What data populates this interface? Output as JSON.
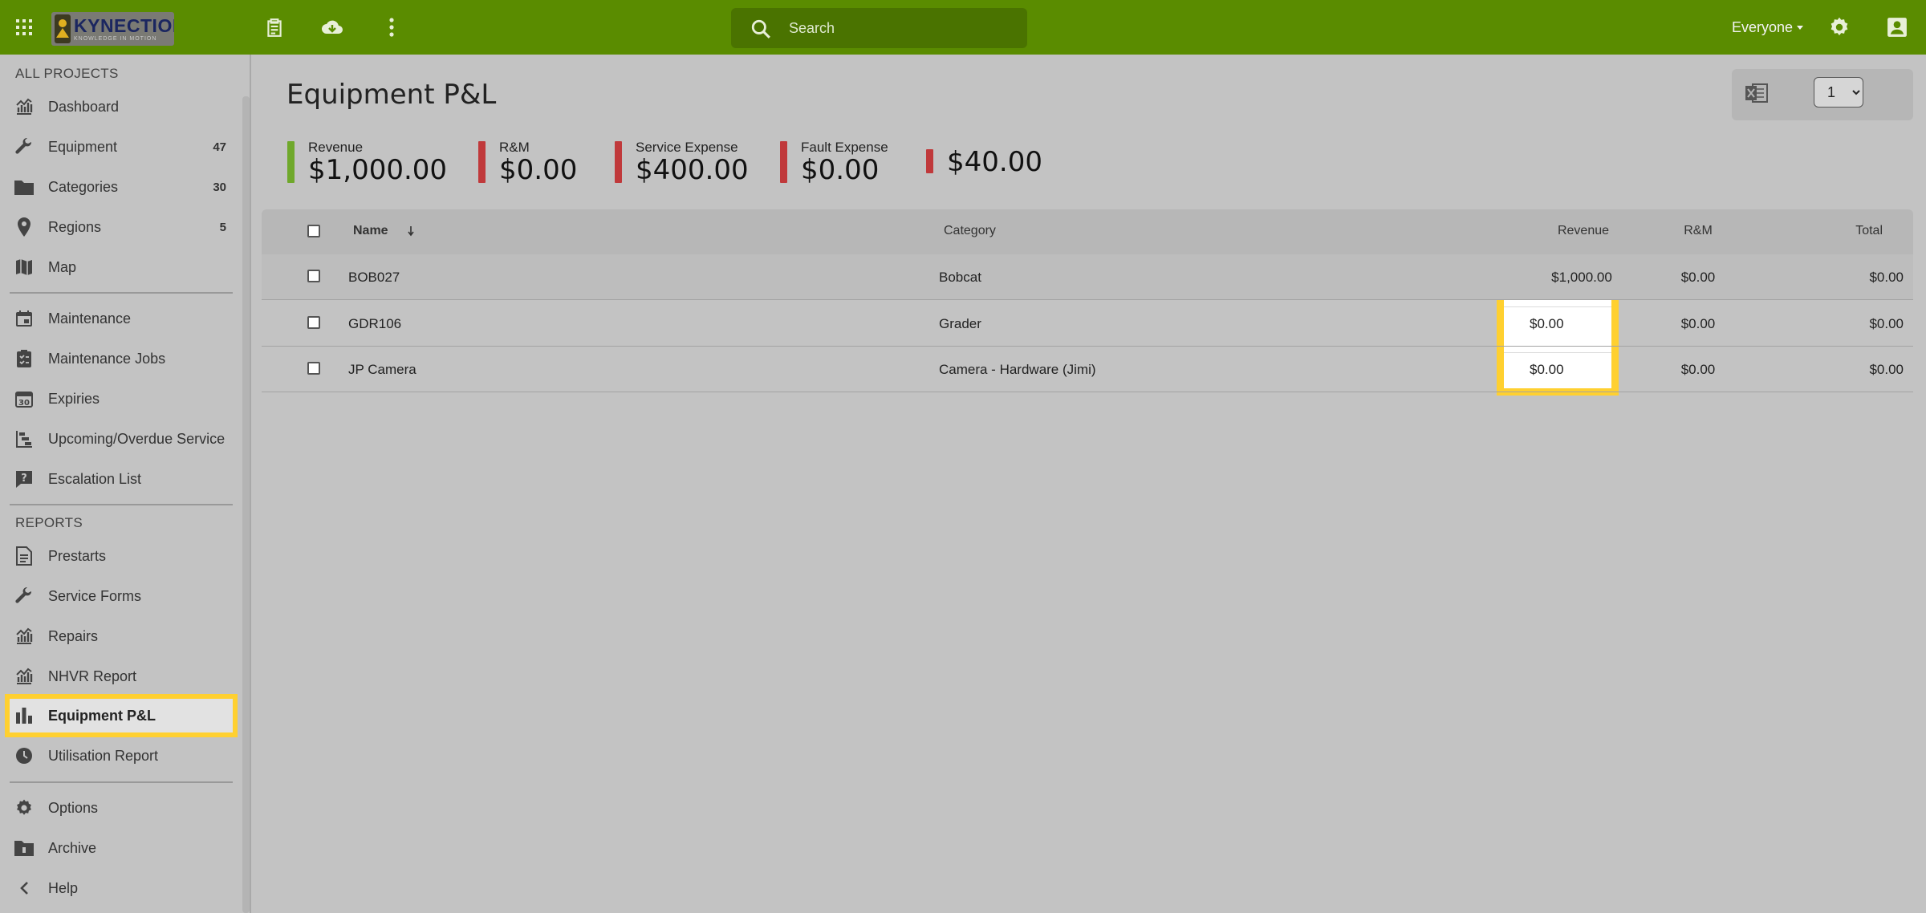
{
  "topbar": {
    "logo_text": "KYNECTION",
    "logo_tagline": "KNOWLEDGE IN MOTION",
    "search_placeholder": "Search",
    "scope": "Everyone",
    "accent_color": "#5a8c00"
  },
  "sidebar": {
    "section_all_projects": "ALL PROJECTS",
    "section_reports": "REPORTS",
    "items_projects": [
      {
        "label": "Dashboard",
        "icon": "chart-icon"
      },
      {
        "label": "Equipment",
        "icon": "wrench-icon",
        "count": "47"
      },
      {
        "label": "Categories",
        "icon": "folder-icon",
        "count": "30"
      },
      {
        "label": "Regions",
        "icon": "location-pin-icon",
        "count": "5"
      },
      {
        "label": "Map",
        "icon": "map-icon"
      }
    ],
    "items_maintenance": [
      {
        "label": "Maintenance",
        "icon": "calendar-icon"
      },
      {
        "label": "Maintenance Jobs",
        "icon": "clipboard-check-icon"
      },
      {
        "label": "Expiries",
        "icon": "calendar-30-icon"
      },
      {
        "label": "Upcoming/Overdue Service",
        "icon": "timeline-icon"
      },
      {
        "label": "Escalation List",
        "icon": "question-bubble-icon"
      }
    ],
    "items_reports": [
      {
        "label": "Prestarts",
        "icon": "document-icon"
      },
      {
        "label": "Service Forms",
        "icon": "wrench-icon"
      },
      {
        "label": "Repairs",
        "icon": "chart-icon"
      },
      {
        "label": "NHVR Report",
        "icon": "chart-icon"
      },
      {
        "label": "Equipment P&L",
        "icon": "bar-chart-icon",
        "active": true
      },
      {
        "label": "Utilisation Report",
        "icon": "clock-icon"
      }
    ],
    "items_bottom": [
      {
        "label": "Options",
        "icon": "gear-icon"
      },
      {
        "label": "Archive",
        "icon": "archive-icon"
      },
      {
        "label": "Help",
        "icon": "chevron-left-icon"
      }
    ]
  },
  "main": {
    "title": "Equipment P&L",
    "page_select_value": "1",
    "summary": [
      {
        "label": "Revenue",
        "value": "$1,000.00",
        "color": "#6fa82b"
      },
      {
        "label": "R&M",
        "value": "$0.00",
        "color": "#c0393b"
      },
      {
        "label": "Service Expense",
        "value": "$400.00",
        "color": "#c0393b"
      },
      {
        "label": "Fault Expense",
        "value": "$0.00",
        "color": "#c0393b"
      },
      {
        "label": "",
        "value": "$40.00",
        "color": "#c0393b"
      }
    ],
    "table": {
      "headers": {
        "name": "Name",
        "category": "Category",
        "revenue": "Revenue",
        "rm": "R&M",
        "total": "Total"
      },
      "rows": [
        {
          "name": "BOB027",
          "category": "Bobcat",
          "revenue": "$1,000.00",
          "rm": "$0.00",
          "total": "$0.00"
        },
        {
          "name": "GDR106",
          "category": "Grader",
          "revenue": "$0.00",
          "rm": "$0.00",
          "total": "$0.00"
        },
        {
          "name": "JP Camera",
          "category": "Camera - Hardware (Jimi)",
          "revenue": "$0.00",
          "rm": "$0.00",
          "total": "$0.00"
        }
      ]
    }
  }
}
